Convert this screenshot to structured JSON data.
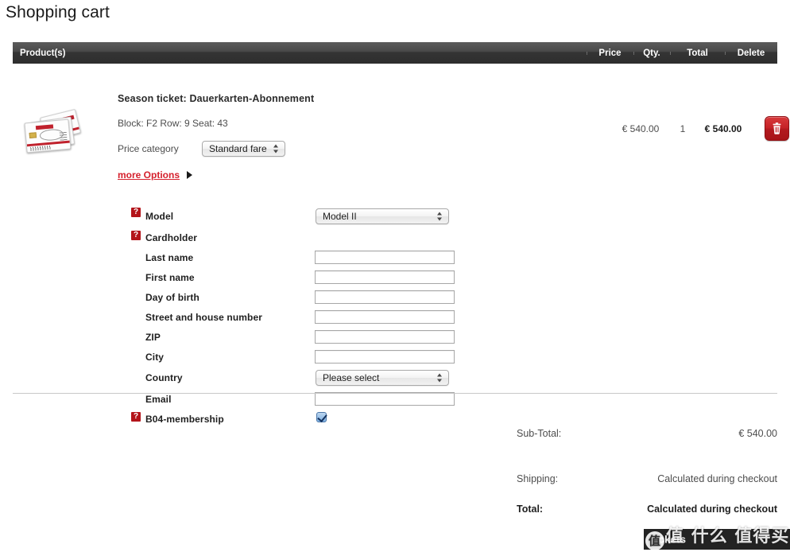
{
  "page": {
    "title": "Shopping cart"
  },
  "cart": {
    "columns": {
      "products": "Product(s)",
      "price": "Price",
      "qty": "Qty.",
      "total": "Total",
      "delete": "Delete"
    },
    "item": {
      "name": "Season ticket: Dauerkarten-Abonnement",
      "seat_info": "Block: F2 Row: 9 Seat: 43",
      "price_category_label": "Price category",
      "price_category_value": "Standard fare",
      "more_options_label": "more Options",
      "price": "€ 540.00",
      "qty": "1",
      "total": "€ 540.00",
      "delete_icon": "trash-icon",
      "thumbnail_alt": "season-ticket-cards-photo"
    }
  },
  "options_form": {
    "help_icon": "?",
    "rows": [
      {
        "label": "Model",
        "help": true,
        "type": "select",
        "value": "Model II"
      },
      {
        "label": "Cardholder",
        "help": true,
        "type": "none",
        "value": ""
      },
      {
        "label": "Last name",
        "help": false,
        "type": "text",
        "value": ""
      },
      {
        "label": "First name",
        "help": false,
        "type": "text",
        "value": ""
      },
      {
        "label": "Day of birth",
        "help": false,
        "type": "text",
        "value": ""
      },
      {
        "label": "Street and house number",
        "help": false,
        "type": "text",
        "value": ""
      },
      {
        "label": "ZIP",
        "help": false,
        "type": "text",
        "value": ""
      },
      {
        "label": "City",
        "help": false,
        "type": "text",
        "value": ""
      },
      {
        "label": "Country",
        "help": false,
        "type": "select",
        "value": "Please select"
      },
      {
        "label": "Email",
        "help": false,
        "type": "text",
        "value": ""
      },
      {
        "label": "B04-membership",
        "help": true,
        "type": "checkbox",
        "value": "checked"
      }
    ]
  },
  "totals": {
    "subtotal_label": "Sub-Total:",
    "subtotal_value": "€ 540.00",
    "shipping_label": "Shipping:",
    "shipping_value": "Calculated during checkout",
    "total_label": "Total:",
    "total_value": "Calculated during checkout"
  },
  "bottom_bar": {
    "text": "tickets",
    "watermark": "值 什么 值得买",
    "watermark_badge": "值"
  },
  "colors": {
    "accent_red": "#d5202c",
    "header_dark": "#343434",
    "help_icon_red": "#b3141a",
    "checkbox_blue": "#7fb0e2"
  }
}
